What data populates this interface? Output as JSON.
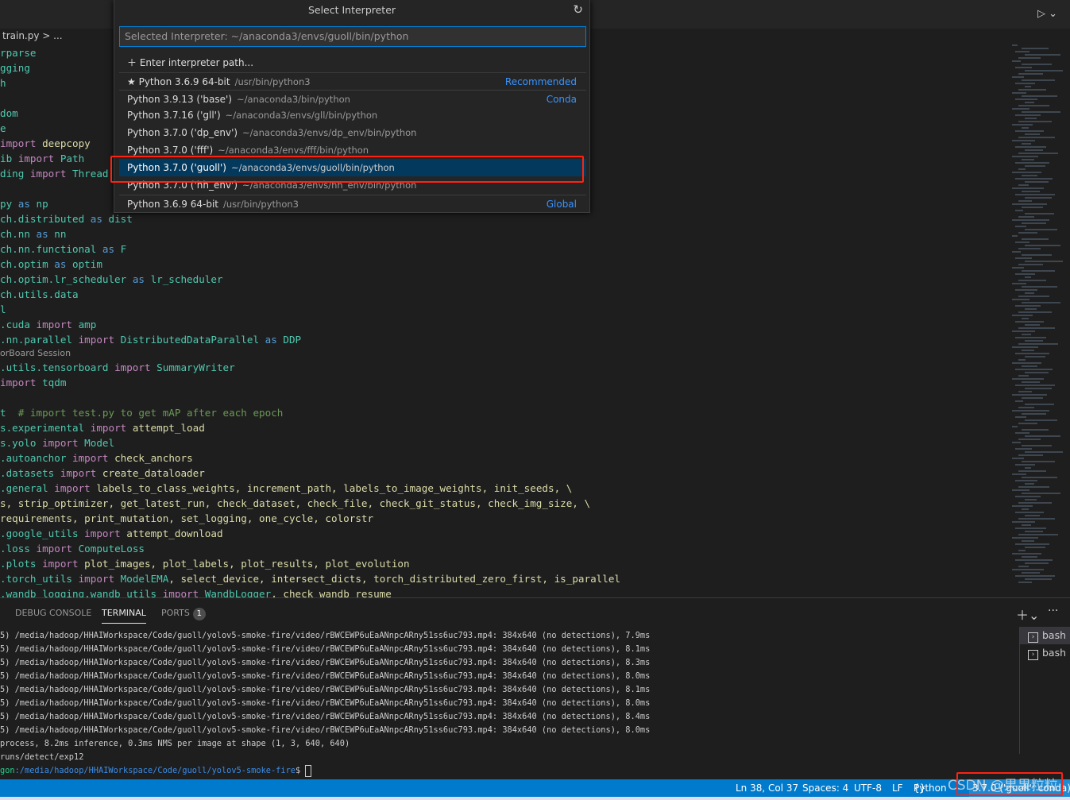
{
  "breadcrumb": "train.py > ...",
  "run_icon": "play-icon",
  "picker": {
    "title": "Select Interpreter",
    "refresh_icon": "refresh-icon",
    "input_value": "Selected Interpreter: ~/anaconda3/envs/guoll/bin/python",
    "enter_path": "Enter interpreter path...",
    "items": [
      {
        "name": "Python 3.6.9 64-bit",
        "path": "/usr/bin/python3",
        "tag": "Recommended",
        "star": true
      },
      {
        "name": "Python 3.9.13 ('base')",
        "path": "~/anaconda3/bin/python",
        "tag": "Conda"
      },
      {
        "name": "Python 3.7.16 ('gll')",
        "path": "~/anaconda3/envs/gll/bin/python",
        "tag": ""
      },
      {
        "name": "Python 3.7.0 ('dp_env')",
        "path": "~/anaconda3/envs/dp_env/bin/python",
        "tag": ""
      },
      {
        "name": "Python 3.7.0 ('fff')",
        "path": "~/anaconda3/envs/fff/bin/python",
        "tag": ""
      },
      {
        "name": "Python 3.7.0 ('guoll')",
        "path": "~/anaconda3/envs/guoll/bin/python",
        "tag": "",
        "selected": true
      },
      {
        "name": "Python 3.7.0 ('hh_env')",
        "path": "~/anaconda3/envs/hh_env/bin/python",
        "tag": ""
      },
      {
        "name": "Python 3.6.9 64-bit",
        "path": "/usr/bin/python3",
        "tag": "Global"
      }
    ]
  },
  "code": [
    [
      [
        "rparse",
        "mod"
      ]
    ],
    [
      [
        "gging",
        "mod"
      ]
    ],
    [
      [
        "h",
        "mod"
      ]
    ],
    [],
    [
      [
        "dom",
        "mod"
      ]
    ],
    [
      [
        "e",
        "mod"
      ]
    ],
    [
      [
        "import ",
        "kw"
      ],
      [
        "deepcopy",
        "id"
      ]
    ],
    [
      [
        "ib ",
        "mod"
      ],
      [
        "import ",
        "kw"
      ],
      [
        "Path",
        "mod"
      ]
    ],
    [
      [
        "ding ",
        "mod"
      ],
      [
        "import ",
        "kw"
      ],
      [
        "Thread",
        "mod"
      ]
    ],
    [],
    [
      [
        "py ",
        "mod"
      ],
      [
        "as ",
        "as"
      ],
      [
        "np",
        "mod"
      ]
    ],
    [
      [
        "ch.distributed ",
        "mod"
      ],
      [
        "as ",
        "as"
      ],
      [
        "dist",
        "mod"
      ]
    ],
    [
      [
        "ch.nn ",
        "mod"
      ],
      [
        "as ",
        "as"
      ],
      [
        "nn",
        "mod"
      ]
    ],
    [
      [
        "ch.nn.functional ",
        "mod"
      ],
      [
        "as ",
        "as"
      ],
      [
        "F",
        "mod"
      ]
    ],
    [
      [
        "ch.optim ",
        "mod"
      ],
      [
        "as ",
        "as"
      ],
      [
        "optim",
        "mod"
      ]
    ],
    [
      [
        "ch.optim.lr_scheduler ",
        "mod"
      ],
      [
        "as ",
        "as"
      ],
      [
        "lr_scheduler",
        "mod"
      ]
    ],
    [
      [
        "ch.utils.data",
        "mod"
      ]
    ],
    [
      [
        "l",
        "mod"
      ]
    ],
    [
      [
        ".cuda ",
        "mod"
      ],
      [
        "import ",
        "kw"
      ],
      [
        "amp",
        "mod"
      ]
    ],
    [
      [
        ".nn.parallel ",
        "mod"
      ],
      [
        "import ",
        "kw"
      ],
      [
        "DistributedDataParallel ",
        "mod"
      ],
      [
        "as ",
        "as"
      ],
      [
        "DDP",
        "mod"
      ]
    ],
    {
      "lens": "orBoard Session"
    },
    [
      [
        ".utils.tensorboard ",
        "mod"
      ],
      [
        "import ",
        "kw"
      ],
      [
        "SummaryWriter",
        "mod"
      ]
    ],
    [
      [
        "import ",
        "kw"
      ],
      [
        "tqdm",
        "mod"
      ]
    ],
    [],
    [
      [
        "t  ",
        "mod"
      ],
      [
        "# import test.py to get mAP after each epoch",
        "cm"
      ]
    ],
    [
      [
        "s.experimental ",
        "mod"
      ],
      [
        "import ",
        "kw"
      ],
      [
        "attempt_load",
        "id"
      ]
    ],
    [
      [
        "s.yolo ",
        "mod"
      ],
      [
        "import ",
        "kw"
      ],
      [
        "Model",
        "mod"
      ]
    ],
    [
      [
        ".autoanchor ",
        "mod"
      ],
      [
        "import ",
        "kw"
      ],
      [
        "check_anchors",
        "id"
      ]
    ],
    [
      [
        ".datasets ",
        "mod"
      ],
      [
        "import ",
        "kw"
      ],
      [
        "create_dataloader",
        "id"
      ]
    ],
    [
      [
        ".general ",
        "mod"
      ],
      [
        "import ",
        "kw"
      ],
      [
        "labels_to_class_weights, increment_path, labels_to_image_weights, init_seeds, \\",
        "id"
      ]
    ],
    [
      [
        "s, strip_optimizer, get_latest_run, check_dataset, check_file, check_git_status, check_img_size, \\",
        "id"
      ]
    ],
    [
      [
        "requirements, print_mutation, set_logging, one_cycle, colorstr",
        "id"
      ]
    ],
    [
      [
        ".google_utils ",
        "mod"
      ],
      [
        "import ",
        "kw"
      ],
      [
        "attempt_download",
        "id"
      ]
    ],
    [
      [
        ".loss ",
        "mod"
      ],
      [
        "import ",
        "kw"
      ],
      [
        "ComputeLoss",
        "mod"
      ]
    ],
    [
      [
        ".plots ",
        "mod"
      ],
      [
        "import ",
        "kw"
      ],
      [
        "plot_images, plot_labels, plot_results, plot_evolution",
        "id"
      ]
    ],
    [
      [
        ".torch_utils ",
        "mod"
      ],
      [
        "import ",
        "kw"
      ],
      [
        "ModelEMA",
        "mod"
      ],
      [
        ", select_device, intersect_dicts, torch_distributed_zero_first, is_parallel",
        "id"
      ]
    ],
    [
      [
        ".wandb_logging.wandb_utils ",
        "mod"
      ],
      [
        "import ",
        "kw"
      ],
      [
        "WandbLogger",
        "mod"
      ],
      [
        ", check_wandb_resume",
        "id"
      ]
    ]
  ],
  "panel": {
    "tabs": [
      "DEBUG CONSOLE",
      "TERMINAL",
      "PORTS"
    ],
    "active": "TERMINAL",
    "ports_badge": "1",
    "add_icon": "plus-icon",
    "more_icon": "ellipsis-icon",
    "terminal_lines": [
      "5) /media/hadoop/HHAIWorkspace/Code/guoll/yolov5-smoke-fire/video/rBWCEWP6uEaANnpcARny51ss6uc793.mp4: 384x640 (no detections), 7.9ms",
      "5) /media/hadoop/HHAIWorkspace/Code/guoll/yolov5-smoke-fire/video/rBWCEWP6uEaANnpcARny51ss6uc793.mp4: 384x640 (no detections), 8.1ms",
      "5) /media/hadoop/HHAIWorkspace/Code/guoll/yolov5-smoke-fire/video/rBWCEWP6uEaANnpcARny51ss6uc793.mp4: 384x640 (no detections), 8.3ms",
      "5) /media/hadoop/HHAIWorkspace/Code/guoll/yolov5-smoke-fire/video/rBWCEWP6uEaANnpcARny51ss6uc793.mp4: 384x640 (no detections), 8.0ms",
      "5) /media/hadoop/HHAIWorkspace/Code/guoll/yolov5-smoke-fire/video/rBWCEWP6uEaANnpcARny51ss6uc793.mp4: 384x640 (no detections), 8.1ms",
      "5) /media/hadoop/HHAIWorkspace/Code/guoll/yolov5-smoke-fire/video/rBWCEWP6uEaANnpcARny51ss6uc793.mp4: 384x640 (no detections), 8.0ms",
      "5) /media/hadoop/HHAIWorkspace/Code/guoll/yolov5-smoke-fire/video/rBWCEWP6uEaANnpcARny51ss6uc793.mp4: 384x640 (no detections), 8.4ms",
      "5) /media/hadoop/HHAIWorkspace/Code/guoll/yolov5-smoke-fire/video/rBWCEWP6uEaANnpcARny51ss6uc793.mp4: 384x640 (no detections), 8.0ms",
      "process, 8.2ms inference, 0.3ms NMS per image at shape (1, 3, 640, 640)",
      "runs/detect/exp12"
    ],
    "prompt_user": "gon",
    "prompt_path": ":/media/hadoop/HHAIWorkspace/Code/guoll/yolov5-smoke-fire",
    "prompt_symbol": "$ ",
    "terminals": [
      "bash",
      "bash"
    ]
  },
  "status": {
    "position": "Ln 38, Col 37",
    "spaces": "Spaces: 4",
    "encoding": "UTF-8",
    "eol": "LF",
    "language": "Python",
    "interpreter": "3.7.0 ('guoll': conda)"
  },
  "watermark": "CSDN @果果粒粒",
  "colors": {
    "accent": "#007acc",
    "highlight_box": "#ff2211",
    "selected_row": "#04395e"
  }
}
